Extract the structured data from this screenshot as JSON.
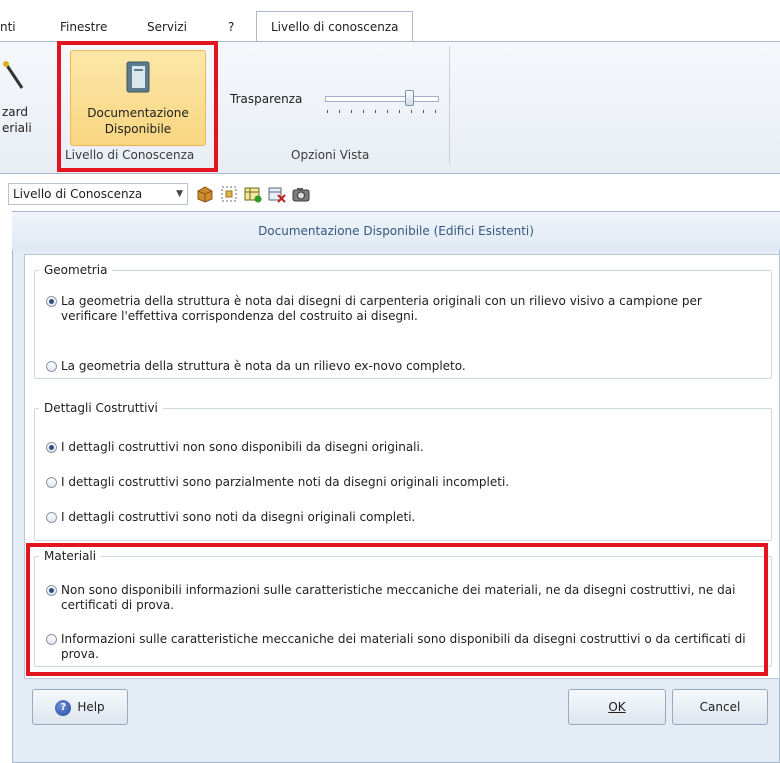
{
  "ribbon_tabs": {
    "partial": "nti",
    "finestre": "Finestre",
    "servizi": "Servizi",
    "help": "?",
    "active": "Livello di conoscenza"
  },
  "ribbon": {
    "wizard_line1": "zard",
    "wizard_line2": "eriali",
    "doc_button_line1": "Documentazione",
    "doc_button_line2": "Disponibile",
    "group_livello": "Livello di Conoscenza",
    "trasparenza_label": "Trasparenza",
    "trasparenza_value": 0.78,
    "group_opzioni": "Opzioni Vista"
  },
  "toolbar": {
    "combo_value": "Livello di Conoscenza",
    "icons": [
      "box-icon",
      "frame-select-icon",
      "table-add-icon",
      "table-delete-icon",
      "camera-icon"
    ]
  },
  "dialog": {
    "title": "Documentazione Disponibile (Edifici Esistenti)",
    "geometria": {
      "legend": "Geometria",
      "opt1": "La geometria della struttura è nota dai disegni di carpenteria originali con un rilievo visivo a campione per verificare l'effettiva corrispondenza del costruito ai disegni.",
      "opt2": "La geometria della struttura è nota da un rilievo ex-novo completo."
    },
    "dettagli": {
      "legend": "Dettagli Costruttivi",
      "opt1": "I dettagli costruttivi non sono disponibili da disegni originali.",
      "opt2": "I dettagli costruttivi sono parzialmente noti da disegni originali incompleti.",
      "opt3": "I dettagli costruttivi sono noti da disegni originali completi."
    },
    "materiali": {
      "legend": "Materiali",
      "opt1": "Non sono disponibili informazioni sulle caratteristiche meccaniche dei materiali, ne da disegni costruttivi, ne dai certificati di prova.",
      "opt2": "Informazioni sulle caratteristiche meccaniche dei materiali sono disponibili da disegni costruttivi o da certificati di prova."
    },
    "help_label": "Help",
    "ok_label": "OK",
    "cancel_label": "Cancel"
  },
  "colors": {
    "highlight": "#e2141f",
    "accent_button": "#f8d681",
    "dialog_title": "#35587f"
  }
}
